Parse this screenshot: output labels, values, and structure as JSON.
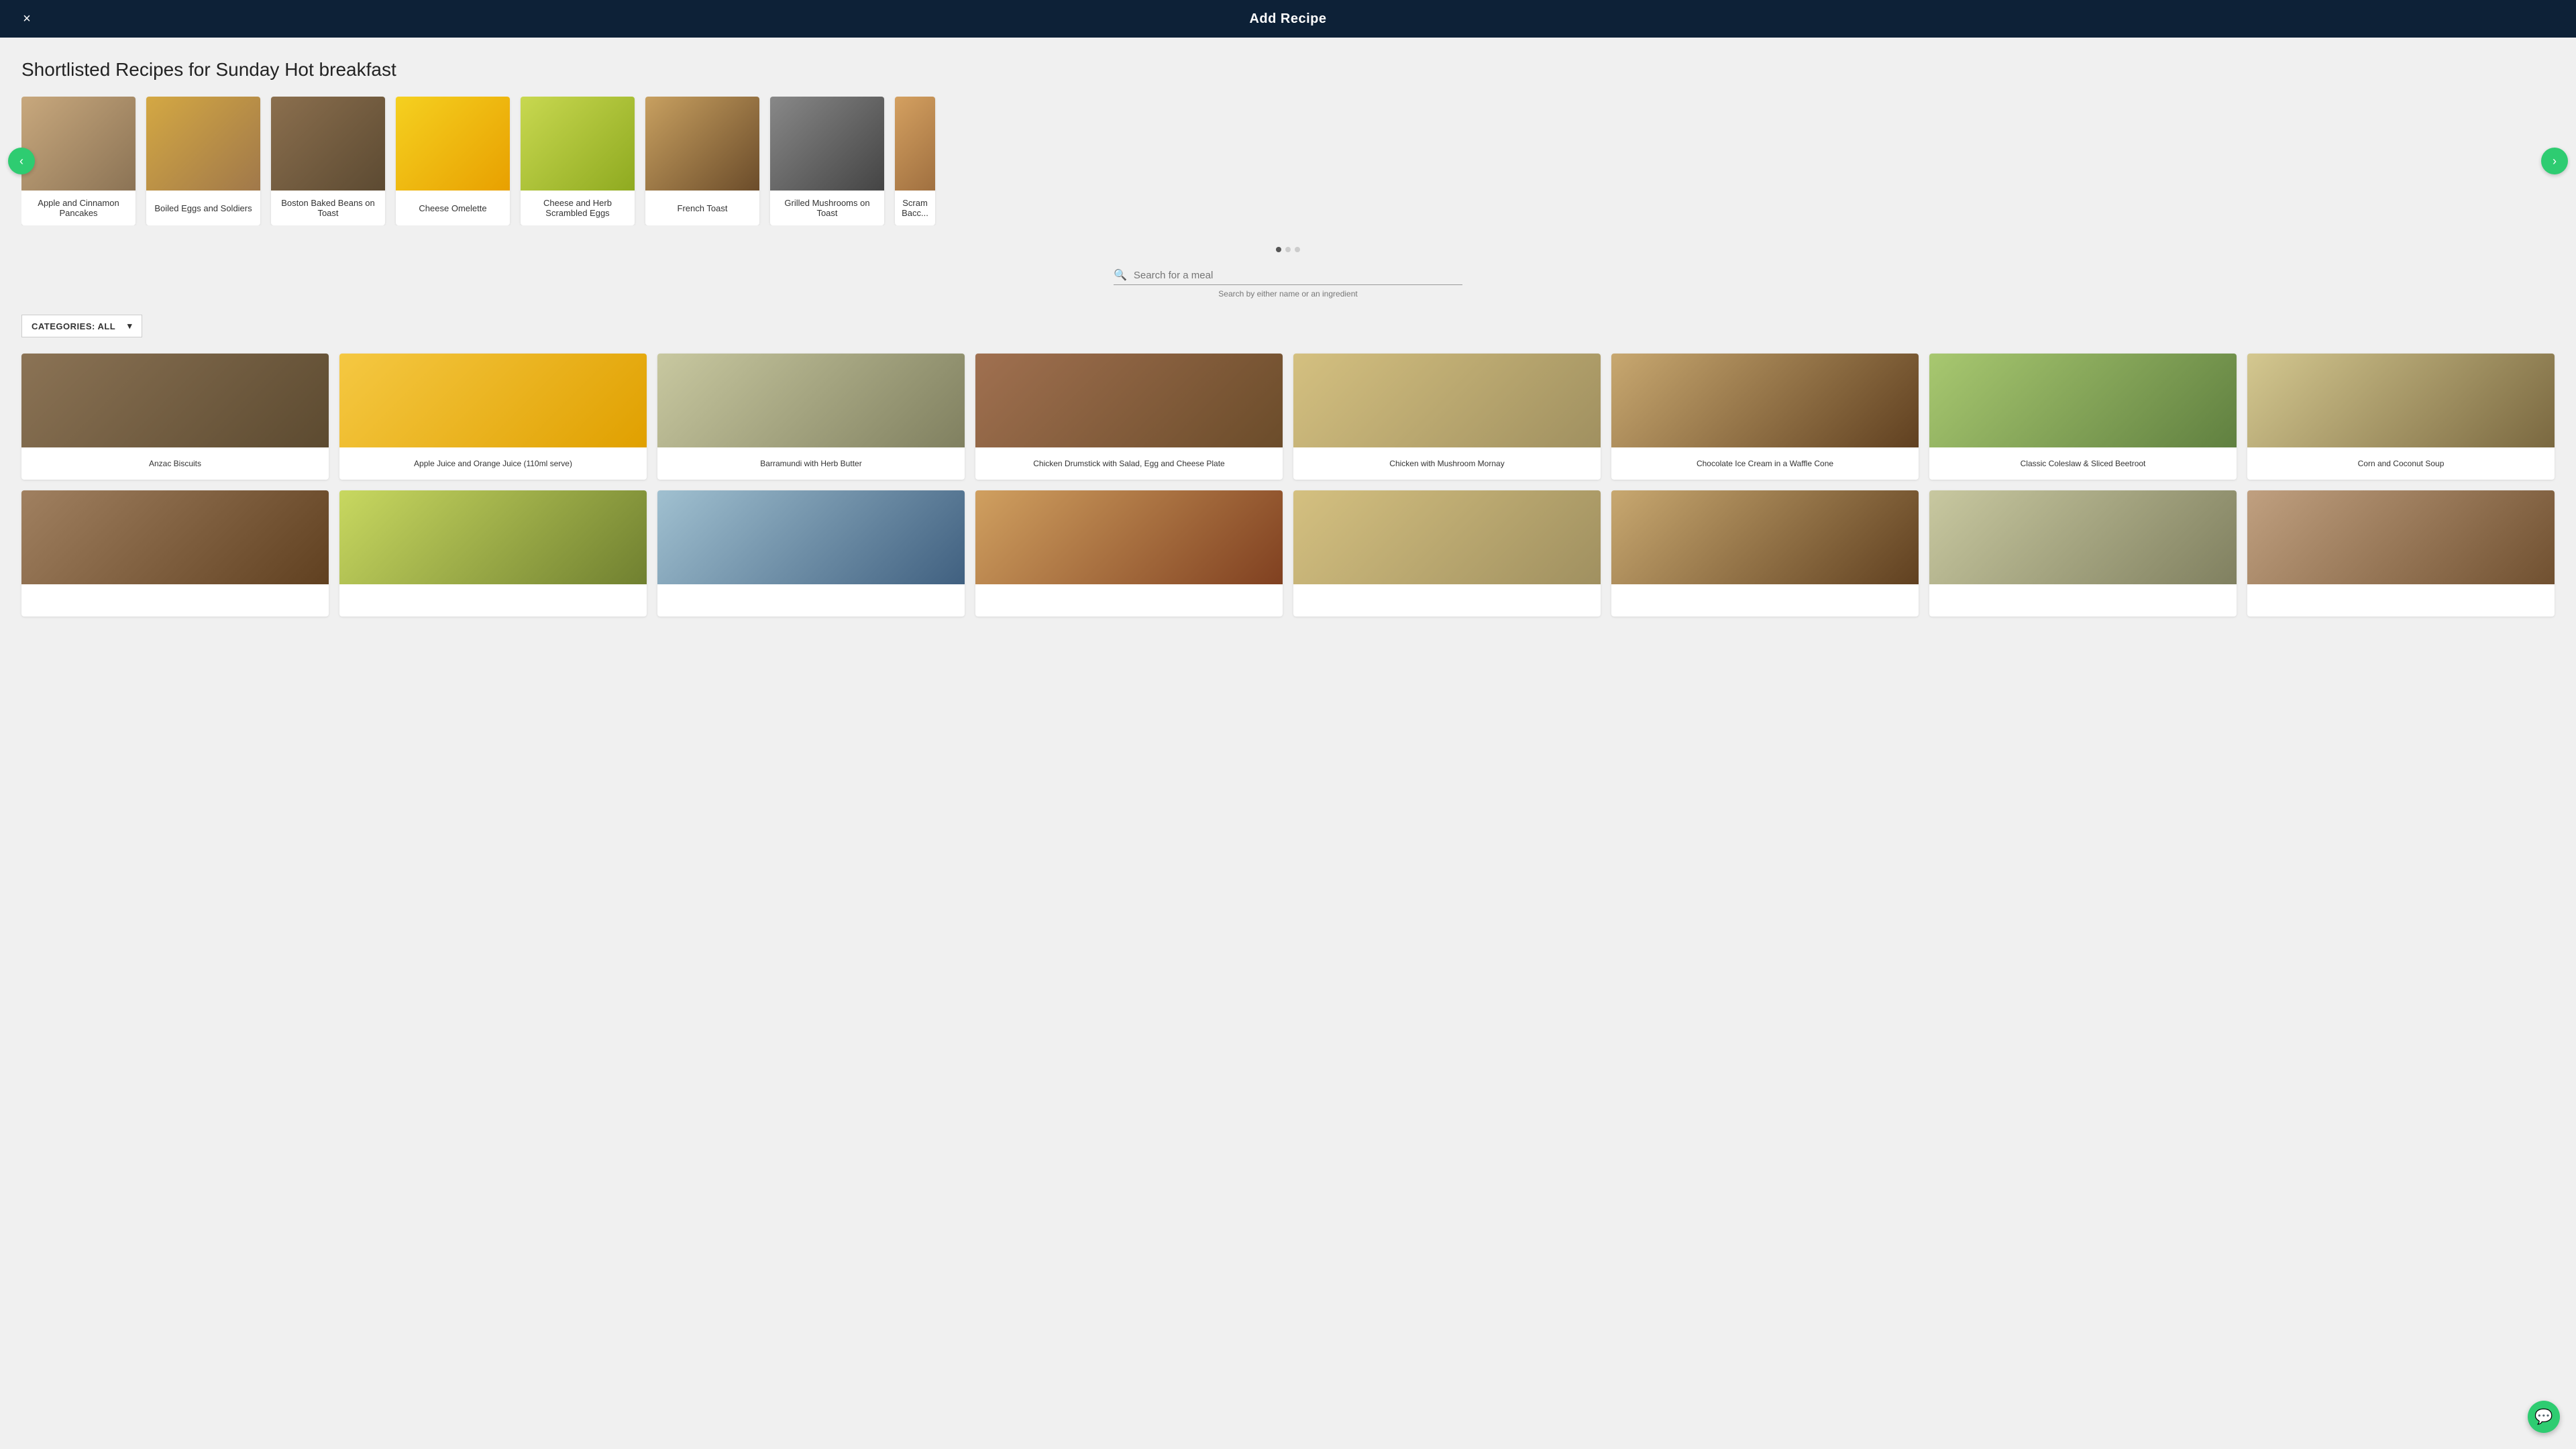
{
  "header": {
    "title": "Add Recipe",
    "close_label": "×"
  },
  "shortlisted": {
    "section_title": "Shortlisted Recipes for Sunday Hot breakfast",
    "prev_btn": "‹",
    "next_btn": "›",
    "recipes": [
      {
        "id": "pancakes",
        "label": "Apple and Cinnamon Pancakes",
        "img_class": "img-pancakes"
      },
      {
        "id": "boiled-eggs",
        "label": "Boiled Eggs and Soldiers",
        "img_class": "img-boiled-eggs"
      },
      {
        "id": "baked-beans",
        "label": "Boston Baked Beans on Toast",
        "img_class": "img-baked-beans"
      },
      {
        "id": "omelette",
        "label": "Cheese Omelette",
        "img_class": "img-cheese-omelette"
      },
      {
        "id": "scrambled-eggs",
        "label": "Cheese and Herb Scrambled Eggs",
        "img_class": "img-scrambled-eggs"
      },
      {
        "id": "french-toast",
        "label": "French Toast",
        "img_class": "img-french-toast"
      },
      {
        "id": "mushrooms",
        "label": "Grilled Mushrooms on Toast",
        "img_class": "img-grilled-mushrooms"
      },
      {
        "id": "scrambled-bacon",
        "label": "Scram Bacc",
        "img_class": "img-scrambled-bacon",
        "partial": true
      }
    ]
  },
  "search": {
    "placeholder": "Search for a meal",
    "hint": "Search by either name or an ingredient"
  },
  "categories": {
    "label": "CATEGORIES: ALL",
    "chevron": "▾"
  },
  "grid": {
    "recipes": [
      {
        "id": "anzac",
        "label": "Anzac Biscuits",
        "img_class": "img-anzac"
      },
      {
        "id": "apple-juice",
        "label": "Apple Juice and Orange Juice (110ml serve)",
        "img_class": "img-apple-juice"
      },
      {
        "id": "barramundi",
        "label": "Barramundi with Herb Butter",
        "img_class": "img-barramundi"
      },
      {
        "id": "chicken-drumstick",
        "label": "Chicken Drumstick with Salad, Egg and Cheese Plate",
        "img_class": "img-chicken-drumstick"
      },
      {
        "id": "chicken-mushroom",
        "label": "Chicken with Mushroom Mornay",
        "img_class": "img-chicken-mushroom"
      },
      {
        "id": "choc-ice-cream",
        "label": "Chocolate Ice Cream in a Waffle Cone",
        "img_class": "img-choc-ice-cream"
      },
      {
        "id": "coleslaw",
        "label": "Classic Coleslaw & Sliced Beetroot",
        "img_class": "img-coleslaw"
      },
      {
        "id": "corn-soup",
        "label": "Corn and Coconut Soup",
        "img_class": "img-corn-soup"
      },
      {
        "id": "bottom1",
        "label": "",
        "img_class": "img-bottom1"
      },
      {
        "id": "bottom2",
        "label": "",
        "img_class": "img-bottom2"
      },
      {
        "id": "bottom3",
        "label": "",
        "img_class": "img-bottom3"
      },
      {
        "id": "bottom4",
        "label": "",
        "img_class": "img-bottom4"
      },
      {
        "id": "bottom5",
        "label": "",
        "img_class": "img-chicken-mushroom"
      },
      {
        "id": "bottom6",
        "label": "",
        "img_class": "img-choc-ice-cream"
      },
      {
        "id": "bottom7",
        "label": "",
        "img_class": "img-barramundi"
      },
      {
        "id": "bottom8",
        "label": "",
        "img_class": "img-bottom8"
      }
    ]
  },
  "chat": {
    "icon": "💬"
  }
}
